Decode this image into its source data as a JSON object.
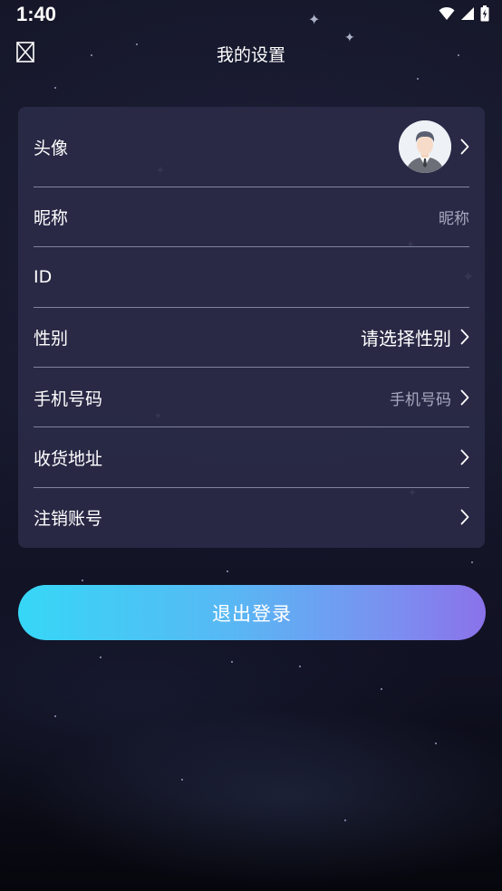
{
  "status_bar": {
    "time": "1:40",
    "icons": [
      "wifi-icon",
      "signal-icon",
      "battery-charging-icon"
    ]
  },
  "header": {
    "title": "我的设置",
    "close_icon": "close-box-icon"
  },
  "settings": {
    "avatar": {
      "label": "头像"
    },
    "nickname": {
      "label": "昵称",
      "value": "昵称"
    },
    "id": {
      "label": "ID",
      "value": ""
    },
    "gender": {
      "label": "性别",
      "value": "请选择性别"
    },
    "phone": {
      "label": "手机号码",
      "value": "手机号码"
    },
    "address": {
      "label": "收货地址"
    },
    "cancel_account": {
      "label": "注销账号"
    }
  },
  "logout": {
    "label": "退出登录"
  },
  "colors": {
    "card_bg": "#2a2a48",
    "logout_gradient_start": "#36d7f6",
    "logout_gradient_end": "#8a72ea",
    "muted_text": "#a6a8bd"
  }
}
